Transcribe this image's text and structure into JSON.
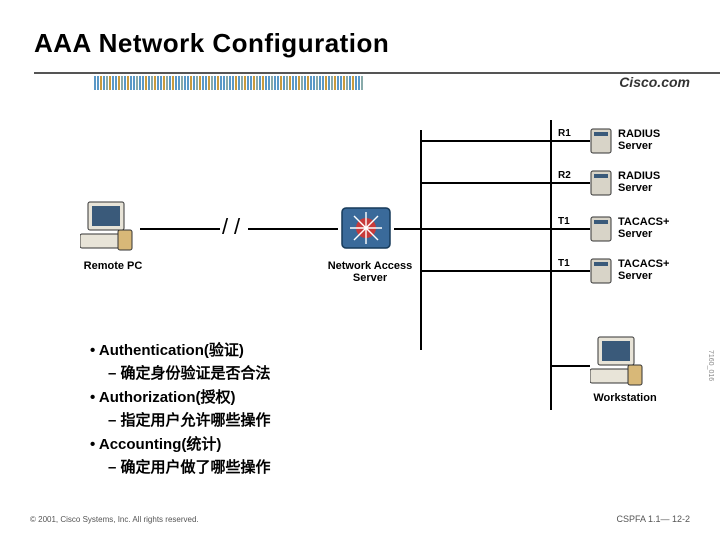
{
  "title": "AAA Network Configuration",
  "brand": "Cisco.com",
  "diagram": {
    "remote_pc": "Remote PC",
    "nas": "Network Access\nServer",
    "workstation": "Workstation",
    "links": {
      "r1": "R1",
      "r2": "R2",
      "t1": "T1",
      "t2": "T1"
    },
    "servers": {
      "radius": "RADIUS\nServer",
      "tacacs": "TACACS+\nServer"
    }
  },
  "bullets": [
    {
      "head": "Authentication(验证)",
      "sub": "确定身份验证是否合法"
    },
    {
      "head": "Authorization(授权)",
      "sub": "指定用户允许哪些操作"
    },
    {
      "head": "Accounting(统计)",
      "sub": "确定用户做了哪些操作"
    }
  ],
  "footer": {
    "left": "© 2001, Cisco Systems, Inc. All rights reserved.",
    "right": "CSPFA 1.1— 12-2"
  },
  "sidetext": "7160_016"
}
